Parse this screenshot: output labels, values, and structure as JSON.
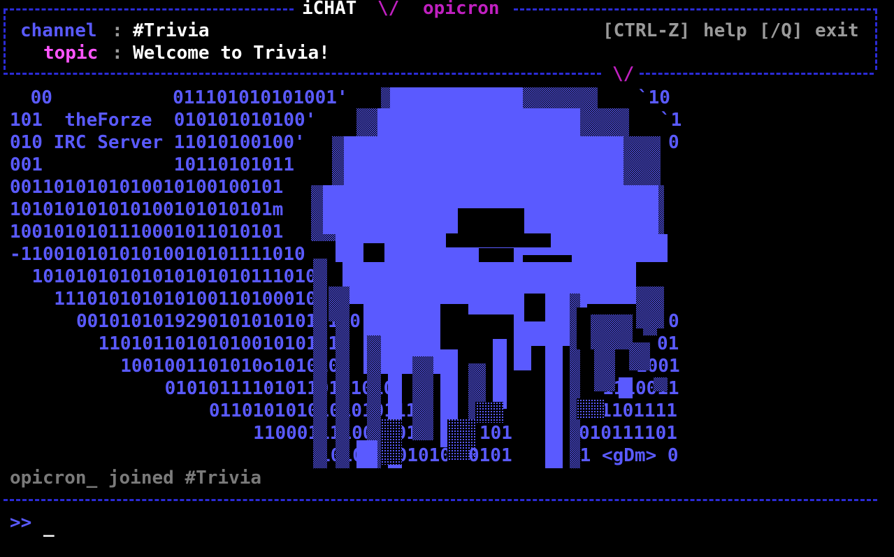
{
  "header": {
    "app_name": "iCHAT",
    "separator": "\\/",
    "nick": "opicron",
    "channel_label": "channel",
    "channel_value": "#Trivia",
    "topic_label": "topic",
    "topic_value": "Welcome to Trivia!",
    "colon": ":",
    "help_key": "[CTRL-Z]",
    "help_label": "help",
    "exit_key": "[/Q]",
    "exit_label": "exit",
    "bottom_separator": "\\/"
  },
  "banner": {
    "left_lines": [
      " 00           011101010101001'",
      "101  theForze  010101010100'",
      "010 IRC Server 11010100100'",
      "001            10110101011",
      "0011010101010010100100101",
      "101010101010100101010101m",
      "1001010101110001011010101",
      "-11001010101010010101111010",
      " 10101010101010101010111010",
      "  1110101010101001101000101",
      "   001010101929010101010101 0",
      "    11010110101010010101111",
      "     1001001101010o1010101",
      "       010101111010110101010",
      "         0110101010101010111",
      "           110001111001001",
      "              101010101010"
    ],
    "right_lines": [
      "`10",
      "`1",
      "0",
      "",
      "",
      "",
      "",
      "",
      "",
      "",
      "0",
      "01",
      "1001",
      "1110011",
      "011101111",
      "010111101",
      "11 <gDm> 0"
    ],
    "mid_labels": [
      "101",
      "0101"
    ]
  },
  "log": {
    "join_message": "opicron_ joined #Trivia"
  },
  "input": {
    "prompt": ">>",
    "cursor": "_"
  },
  "colors": {
    "frame": "#2b2bd6",
    "art_blue": "#5a5aff",
    "pink": "#ff55ff",
    "magenta": "#c020c0"
  }
}
